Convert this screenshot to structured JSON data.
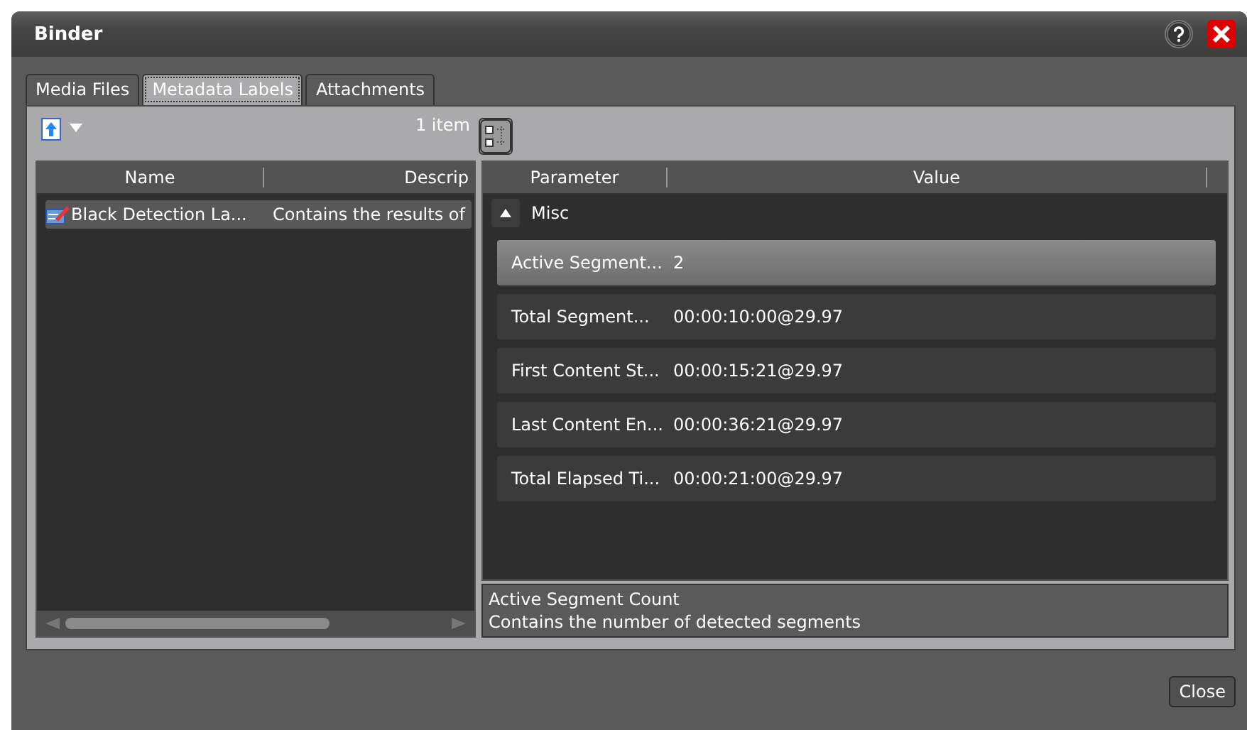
{
  "window": {
    "title": "Binder"
  },
  "tabs": [
    {
      "label": "Media Files",
      "selected": false
    },
    {
      "label": "Metadata Labels",
      "selected": true
    },
    {
      "label": "Attachments",
      "selected": false
    }
  ],
  "list": {
    "count": "1 item",
    "columns": [
      "Name",
      "Descrip"
    ],
    "rows": [
      {
        "name": "Black Detection La...",
        "description": "Contains the results of",
        "selected": true
      }
    ]
  },
  "properties": {
    "columns": [
      "Parameter",
      "Value"
    ],
    "section": {
      "label": "Misc",
      "expanded": true
    },
    "rows": [
      {
        "parameter": "Active Segment...",
        "value": "2",
        "selected": true
      },
      {
        "parameter": "Total Segment...",
        "value": "00:00:10:00@29.97",
        "selected": false
      },
      {
        "parameter": "First Content St...",
        "value": "00:00:15:21@29.97",
        "selected": false
      },
      {
        "parameter": "Last Content En...",
        "value": "00:00:36:21@29.97",
        "selected": false
      },
      {
        "parameter": "Total Elapsed Ti...",
        "value": "00:00:21:00@29.97",
        "selected": false
      }
    ],
    "description": {
      "title": "Active Segment Count",
      "text": "Contains the number of detected segments"
    }
  },
  "buttons": [
    "Close"
  ]
}
